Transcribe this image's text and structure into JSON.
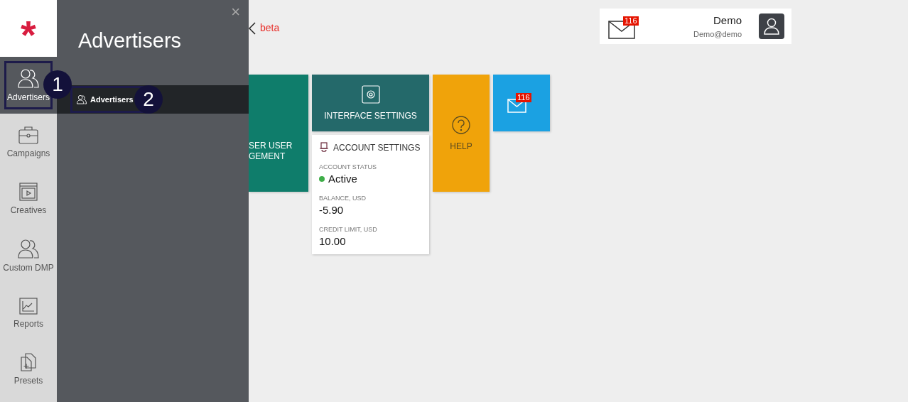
{
  "logo": "*",
  "nav": [
    {
      "label": "Advertisers",
      "kind": "people",
      "selected": true
    },
    {
      "label": "Campaigns",
      "kind": "briefcase",
      "selected": false
    },
    {
      "label": "Creatives",
      "kind": "video",
      "selected": false
    },
    {
      "label": "Custom DMP",
      "kind": "people",
      "selected": false
    },
    {
      "label": "Reports",
      "kind": "chart",
      "selected": false
    },
    {
      "label": "Presets",
      "kind": "docs",
      "selected": false
    }
  ],
  "flyout": {
    "close": "×",
    "title": "Advertisers",
    "items": [
      {
        "label": "Advertisers",
        "selected": true
      }
    ]
  },
  "callouts": [
    "1",
    "2"
  ],
  "header": {
    "beta": "beta",
    "mail_badge": "116",
    "user_name": "Demo",
    "user_email": "Demo@demo"
  },
  "tiles": {
    "user_management": [
      "SER USER",
      "GEMENT"
    ],
    "interface_settings": "INTERFACE SETTINGS",
    "account": {
      "title": "ACCOUNT SETTINGS",
      "status_label": "ACCOUNT STATUS",
      "status": "Active",
      "balance_label": "BALANCE, USD",
      "balance": "-5.90",
      "credit_label": "CREDIT LIMIT, USD",
      "credit": "10.00"
    },
    "help": "HELP",
    "messages_badge": "116"
  }
}
